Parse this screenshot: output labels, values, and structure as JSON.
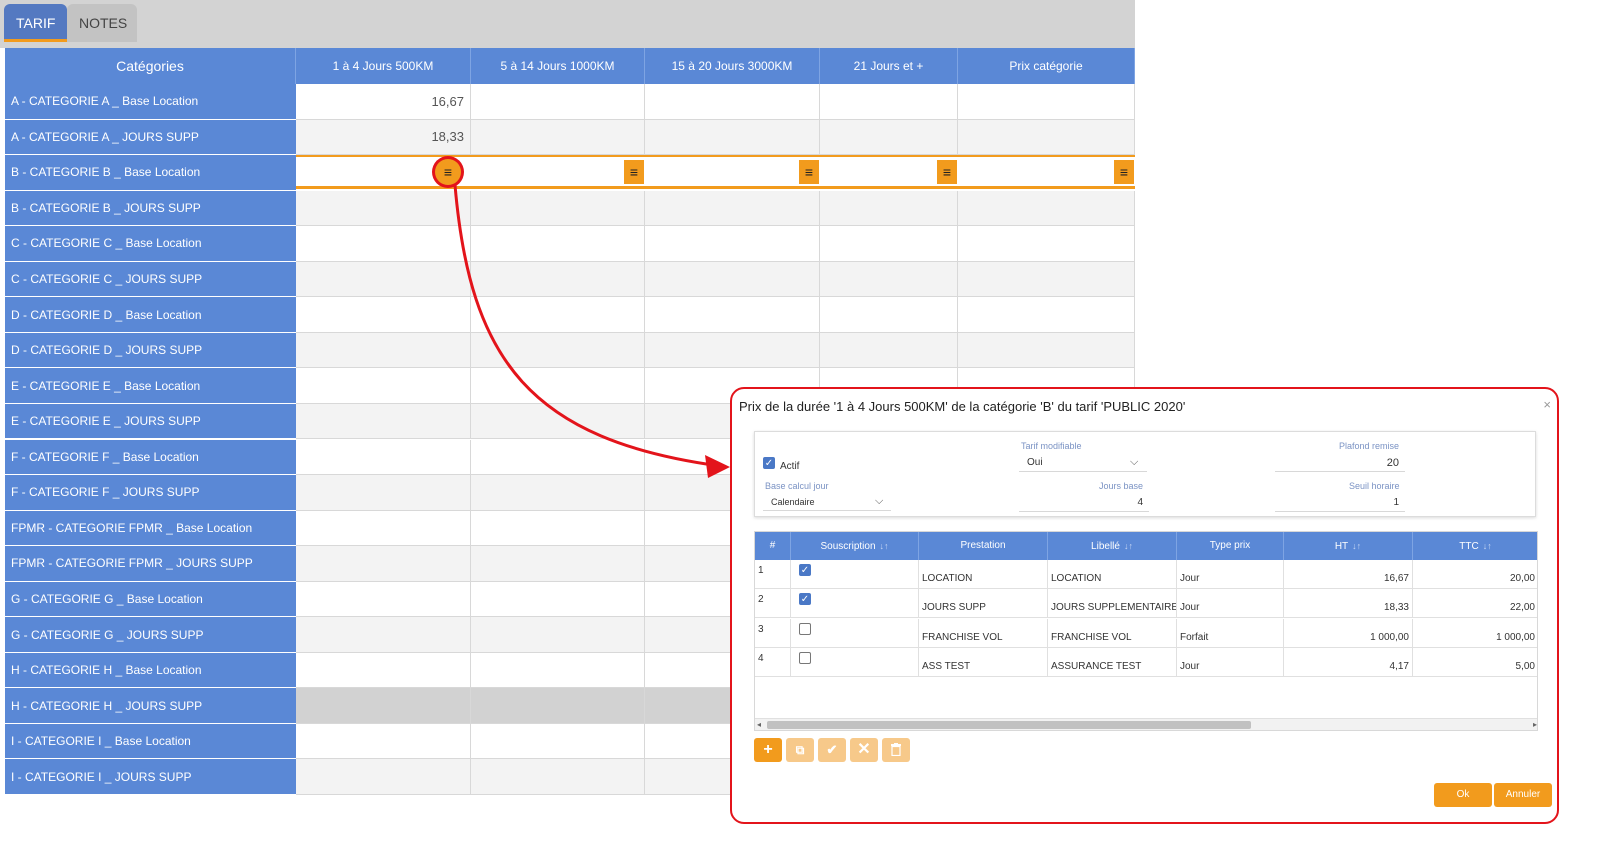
{
  "tabs": [
    {
      "label": "TARIF",
      "active": true
    },
    {
      "label": "NOTES",
      "active": false
    }
  ],
  "grid": {
    "headers": [
      "Catégories",
      "1 à 4 Jours 500KM",
      "5 à 14 Jours 1000KM",
      "15 à 20 Jours 3000KM",
      "21 Jours et +",
      "Prix catégorie"
    ],
    "rows": [
      {
        "label": "A - CATEGORIE A _ Base Location",
        "values": [
          "16,67",
          "",
          "",
          "",
          ""
        ]
      },
      {
        "label": "A - CATEGORIE A _ JOURS SUPP",
        "values": [
          "18,33",
          "",
          "",
          "",
          ""
        ]
      },
      {
        "label": "B - CATEGORIE B _ Base Location",
        "values": [
          "",
          "",
          "",
          "",
          ""
        ],
        "editing": true
      },
      {
        "label": "B - CATEGORIE B _ JOURS SUPP",
        "values": [
          "",
          "",
          "",
          "",
          ""
        ]
      },
      {
        "label": "C - CATEGORIE C _ Base Location",
        "values": [
          "",
          "",
          "",
          "",
          ""
        ]
      },
      {
        "label": "C - CATEGORIE C _ JOURS SUPP",
        "values": [
          "",
          "",
          "",
          "",
          ""
        ]
      },
      {
        "label": "D - CATEGORIE D _ Base Location",
        "values": [
          "",
          "",
          "",
          "",
          ""
        ]
      },
      {
        "label": "D - CATEGORIE D _ JOURS SUPP",
        "values": [
          "",
          "",
          "",
          "",
          ""
        ]
      },
      {
        "label": "E - CATEGORIE E _ Base Location",
        "values": [
          "",
          "",
          "",
          "",
          ""
        ]
      },
      {
        "label": "E - CATEGORIE E _ JOURS SUPP",
        "values": [
          "",
          "",
          "",
          "",
          ""
        ]
      },
      {
        "label": "F - CATEGORIE F _ Base Location",
        "values": [
          "",
          "",
          "",
          "",
          ""
        ]
      },
      {
        "label": "F - CATEGORIE F _ JOURS SUPP",
        "values": [
          "",
          "",
          "",
          "",
          ""
        ]
      },
      {
        "label": "FPMR - CATEGORIE FPMR _ Base Location",
        "values": [
          "",
          "",
          "",
          "",
          ""
        ]
      },
      {
        "label": "FPMR - CATEGORIE FPMR _ JOURS SUPP",
        "values": [
          "",
          "",
          "",
          "",
          ""
        ]
      },
      {
        "label": "G - CATEGORIE G _ Base Location",
        "values": [
          "",
          "",
          "",
          "",
          ""
        ]
      },
      {
        "label": "G - CATEGORIE G _ JOURS SUPP",
        "values": [
          "",
          "",
          "",
          "",
          ""
        ]
      },
      {
        "label": "H - CATEGORIE H _ Base Location",
        "values": [
          "",
          "",
          "",
          "",
          ""
        ]
      },
      {
        "label": "H - CATEGORIE H _ JOURS SUPP",
        "values": [
          "",
          "",
          "",
          "",
          ""
        ],
        "disabled": true
      },
      {
        "label": "I - CATEGORIE I _ Base Location",
        "values": [
          "",
          "",
          "",
          "",
          ""
        ]
      },
      {
        "label": "I - CATEGORIE I _ JOURS SUPP",
        "values": [
          "",
          "",
          "",
          "",
          ""
        ]
      }
    ],
    "edit_icon": "hamburger-menu-icon"
  },
  "dialog": {
    "title": "Prix de la durée '1 à 4 Jours 500KM' de la catégorie 'B' du tarif 'PUBLIC 2020'",
    "close": "×",
    "form": {
      "actif_label": "Actif",
      "actif_checked": true,
      "tarif_modifiable_label": "Tarif modifiable",
      "tarif_modifiable_value": "Oui",
      "plafond_remise_label": "Plafond remise",
      "plafond_remise_value": "20",
      "base_calcul_label": "Base calcul jour",
      "base_calcul_value": "Calendaire",
      "jours_base_label": "Jours base",
      "jours_base_value": "4",
      "seuil_horaire_label": "Seuil horaire",
      "seuil_horaire_value": "1"
    },
    "table": {
      "headers": [
        "#",
        "Souscription",
        "Prestation",
        "Libellé",
        "Type prix",
        "HT",
        "TTC"
      ],
      "sort_icon": "↓↑",
      "rows": [
        {
          "idx": "1",
          "checked": true,
          "prestation": "LOCATION",
          "libelle": "LOCATION",
          "type": "Jour",
          "ht": "16,67",
          "ttc": "20,00"
        },
        {
          "idx": "2",
          "checked": true,
          "prestation": "JOURS SUPP",
          "libelle": "JOURS SUPPLEMENTAIRES",
          "type": "Jour",
          "ht": "18,33",
          "ttc": "22,00"
        },
        {
          "idx": "3",
          "checked": false,
          "prestation": "FRANCHISE VOL",
          "libelle": "FRANCHISE VOL",
          "type": "Forfait",
          "ht": "1 000,00",
          "ttc": "1 000,00"
        },
        {
          "idx": "4",
          "checked": false,
          "prestation": "ASS TEST",
          "libelle": "ASSURANCE TEST",
          "type": "Jour",
          "ht": "4,17",
          "ttc": "5,00"
        }
      ]
    },
    "toolbar": {
      "add_icon": "plus-icon",
      "edit_icon": "external-edit-icon",
      "validate_icon": "check-icon",
      "cancel_icon": "cross-icon",
      "delete_icon": "trash-icon"
    },
    "buttons": {
      "ok": "Ok",
      "cancel": "Annuler"
    }
  },
  "colors": {
    "header_blue": "#5a88d6",
    "accent_orange": "#f29b1d",
    "highlight_red": "#e3141b"
  }
}
